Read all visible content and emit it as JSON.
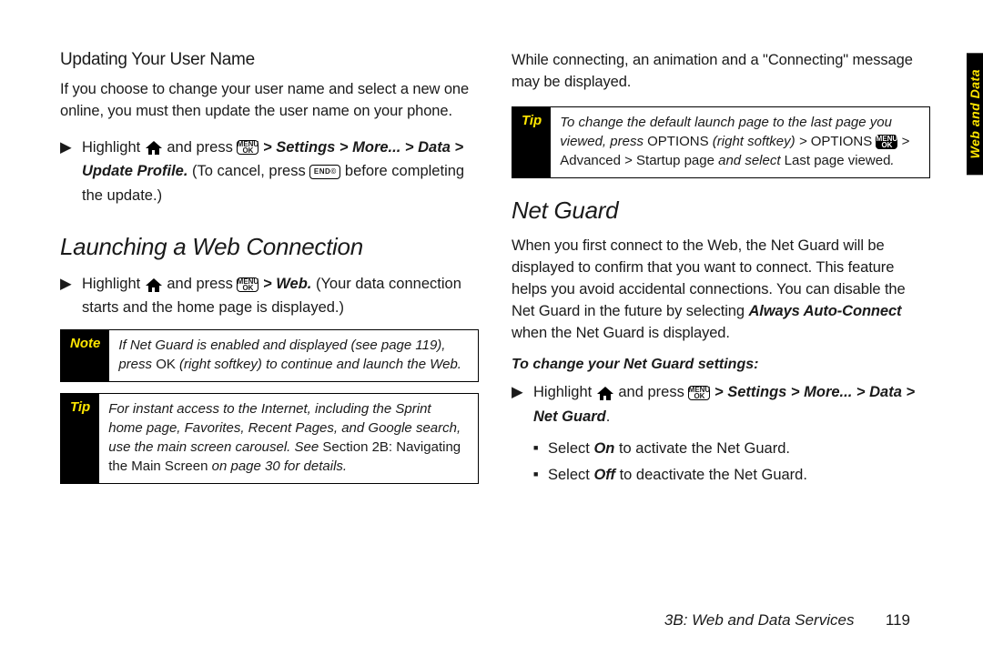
{
  "sideTab": "Web and Data",
  "footer": {
    "section": "3B: Web and Data Services",
    "page": "119"
  },
  "left": {
    "h1": "Updating Your User Name",
    "p1": "If you choose to change your user name and select a new one online, you must then update the user name on your phone.",
    "step1_a": "Highlight ",
    "step1_b": " and press ",
    "step1_c": " > Settings > More... > Data > Update Profile.",
    "step1_d": " (To cancel, press ",
    "step1_e": " before completing the update.)",
    "h2": "Launching a Web Connection",
    "step2_a": "Highlight ",
    "step2_b": " and press ",
    "step2_c": " > Web.",
    "step2_d": " (Your data connection starts and the home page is displayed.)",
    "note_label": "Note",
    "note_a": "If Net Guard is enabled and displayed (see page 119), press ",
    "note_b": "OK",
    "note_c": " (right softkey) to continue and launch the Web.",
    "tip_label": "Tip",
    "tip_a": "For instant access to the Internet, including the Sprint home page, Favorites, Recent Pages, and Google search, use the main screen carousel. See ",
    "tip_b": "Section 2B: Navigating the Main Screen",
    "tip_c": " on page 30 for details."
  },
  "right": {
    "p0": "While connecting, an animation and a \"Connecting\" message may be displayed.",
    "tip_label": "Tip",
    "tip_a": "To change the default launch page to the last page you viewed, press ",
    "tip_b": "OPTIONS",
    "tip_c": " (right softkey) > ",
    "tip_d": "OPTIONS",
    "tip_e": " > Advanced > Startup page",
    "tip_f": " and select ",
    "tip_g": "Last page viewed",
    "tip_h": ".",
    "h1": "Net Guard",
    "p1_a": "When you first connect to the Web, the Net Guard will be displayed to confirm that you want to connect. This feature helps you avoid accidental connections. You can disable the Net Guard in the future by selecting ",
    "p1_b": "Always Auto-Connect",
    "p1_c": " when the Net Guard is displayed.",
    "sub": "To change your Net Guard settings:",
    "step_a": "Highlight ",
    "step_b": " and press ",
    "step_c": " > Settings > More... > Data > Net Guard",
    "step_d": ".",
    "b1_a": "Select ",
    "b1_b": "On",
    "b1_c": " to activate the Net Guard.",
    "b2_a": "Select ",
    "b2_b": "Off",
    "b2_c": " to deactivate the Net Guard."
  },
  "icons": {
    "menuok": "MENU\nOK",
    "end": "END©"
  }
}
